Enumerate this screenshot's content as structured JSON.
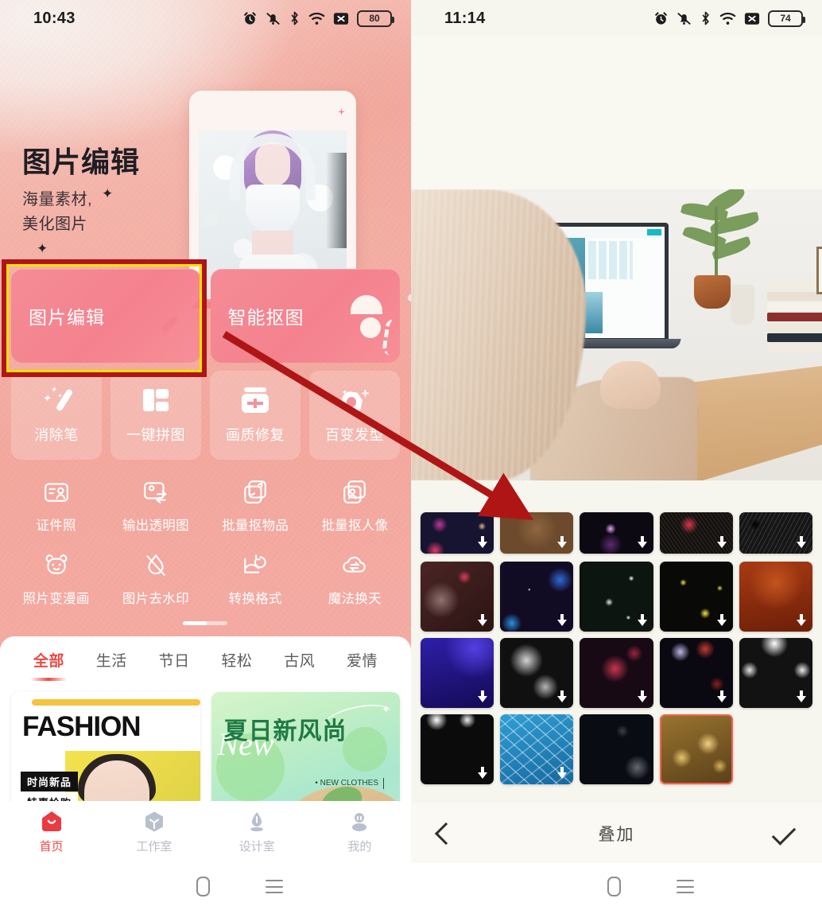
{
  "left": {
    "status": {
      "time": "10:43",
      "battery": "80",
      "icons": [
        "alarm-icon",
        "mute-icon",
        "bluetooth-icon",
        "wifi-icon",
        "no-sim-icon",
        "battery-icon"
      ]
    },
    "hero": {
      "title": "图片编辑",
      "sub_line1": "海量素材,",
      "sub_line2": "美化图片",
      "carousel_dots": 4,
      "carousel_active": 1
    },
    "primary_actions": [
      {
        "label": "图片编辑",
        "icon": "image-edit-icon"
      },
      {
        "label": "智能抠图",
        "icon": "person-cutout-icon"
      }
    ],
    "tiles": [
      {
        "label": "消除笔",
        "icon": "magic-wand-icon"
      },
      {
        "label": "一键拼图",
        "icon": "collage-grid-icon"
      },
      {
        "label": "画质修复",
        "icon": "quality-repair-icon"
      },
      {
        "label": "百变发型",
        "icon": "hairstyle-icon"
      }
    ],
    "tools_row1": [
      {
        "label": "证件照",
        "icon": "id-photo-icon"
      },
      {
        "label": "输出透明图",
        "icon": "transparent-export-icon"
      },
      {
        "label": "批量抠物品",
        "icon": "batch-object-cutout-icon"
      },
      {
        "label": "批量抠人像",
        "icon": "batch-portrait-cutout-icon"
      }
    ],
    "tools_row2": [
      {
        "label": "照片变漫画",
        "icon": "cartoonify-icon"
      },
      {
        "label": "图片去水印",
        "icon": "watermark-remove-icon"
      },
      {
        "label": "转换格式",
        "icon": "format-convert-icon"
      },
      {
        "label": "魔法换天",
        "icon": "sky-replace-icon"
      }
    ],
    "categories": [
      "全部",
      "生活",
      "节日",
      "轻松",
      "古风",
      "爱情"
    ],
    "category_active": "全部",
    "templates": [
      {
        "title": "FASHION",
        "tag_top": "时尚新品",
        "tag_bottom": "特惠抢购"
      },
      {
        "title": "夏日新风尚",
        "script": "New",
        "note": "• NEW\nCLOTHES"
      }
    ],
    "bottom_nav": [
      {
        "label": "首页",
        "icon": "home-icon",
        "active": true
      },
      {
        "label": "工作室",
        "icon": "workshop-cube-icon",
        "active": false
      },
      {
        "label": "设计室",
        "icon": "pen-nib-icon",
        "active": false
      },
      {
        "label": "我的",
        "icon": "profile-icon",
        "active": false
      }
    ]
  },
  "right": {
    "status": {
      "time": "11:14",
      "battery": "74",
      "icons": [
        "alarm-icon",
        "mute-icon",
        "bluetooth-icon",
        "wifi-icon",
        "no-sim-icon",
        "battery-icon"
      ]
    },
    "toolbar": {
      "back": "back-chevron-icon",
      "title": "叠加",
      "confirm": "check-icon"
    },
    "overlay_thumbs": [
      {
        "id": 1,
        "style": "bokeh-magenta-dark",
        "downloadable": true,
        "selected": false
      },
      {
        "id": 2,
        "style": "brown-dust",
        "downloadable": true,
        "selected": false
      },
      {
        "id": 3,
        "style": "violet-flare-dark",
        "downloadable": true,
        "selected": false
      },
      {
        "id": 4,
        "style": "red-neon-grain",
        "downloadable": true,
        "selected": false
      },
      {
        "id": 5,
        "style": "black-grain-crack",
        "downloadable": true,
        "selected": false
      },
      {
        "id": 6,
        "style": "red-smoke-nebula",
        "downloadable": true,
        "selected": false
      },
      {
        "id": 7,
        "style": "blue-purple-starfield",
        "downloadable": true,
        "selected": false
      },
      {
        "id": 8,
        "style": "white-snow-specks",
        "downloadable": true,
        "selected": false
      },
      {
        "id": 9,
        "style": "yellow-bokeh-dots",
        "downloadable": true,
        "selected": false
      },
      {
        "id": 10,
        "style": "orange-rust-gradient",
        "downloadable": true,
        "selected": false
      },
      {
        "id": 11,
        "style": "deep-blue-glow",
        "downloadable": true,
        "selected": false
      },
      {
        "id": 12,
        "style": "grey-smoke",
        "downloadable": true,
        "selected": false
      },
      {
        "id": 13,
        "style": "pink-sphere-particles",
        "downloadable": true,
        "selected": false
      },
      {
        "id": 14,
        "style": "red-blue-bokeh-stars",
        "downloadable": true,
        "selected": false
      },
      {
        "id": 15,
        "style": "white-clouds-dark",
        "downloadable": true,
        "selected": false
      },
      {
        "id": 16,
        "style": "dark-light-leak",
        "downloadable": true,
        "selected": false
      },
      {
        "id": 17,
        "style": "blue-water-caustics",
        "downloadable": true,
        "selected": false
      },
      {
        "id": 18,
        "style": "dark-soft-bokeh",
        "downloadable": false,
        "selected": false
      },
      {
        "id": 19,
        "style": "gold-warm-bokeh",
        "downloadable": false,
        "selected": true
      }
    ]
  },
  "android_nav": {
    "back": "back-triangle-icon",
    "home": "home-pill-icon",
    "recents": "menu-lines-icon"
  },
  "annotations": {
    "highlight_box": {
      "color_outer": "#b01515",
      "color_inner": "#f5e000",
      "target": "图片编辑"
    },
    "arrow": {
      "color": "#b01515",
      "from": "图片编辑按钮",
      "to": "叠加素材缩略图"
    }
  },
  "colors": {
    "left_bg": "#f3a79d",
    "accent_red": "#ea4a43",
    "button_pink": "#f4828e",
    "annotation_red": "#b01515",
    "annotation_yellow": "#f5e000",
    "right_bg": "#f7f6ee",
    "selected_border": "#f4614f"
  }
}
